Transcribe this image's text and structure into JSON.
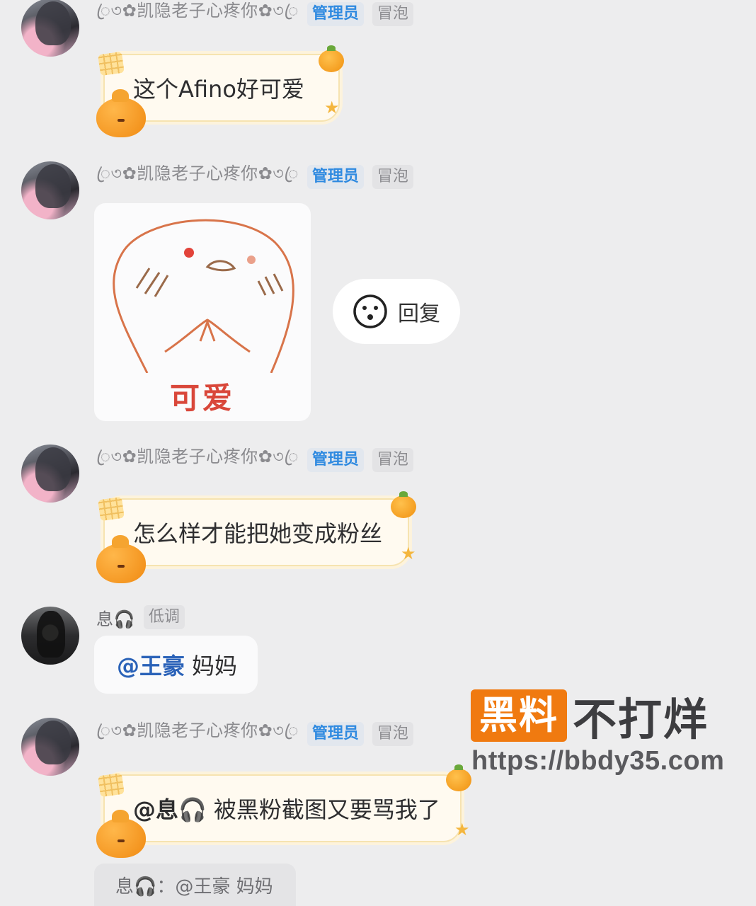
{
  "messages": [
    {
      "nickname": "ꦿ৩✿凯隐老子心疼你✿৩ꦿ",
      "badges": {
        "admin": "管理员",
        "bubble": "冒泡"
      },
      "text": "这个Afino好可爱"
    },
    {
      "nickname": "ꦿ৩✿凯隐老子心疼你✿৩ꦿ",
      "badges": {
        "admin": "管理员",
        "bubble": "冒泡"
      },
      "sticker_caption": "可爱"
    },
    {
      "nickname": "ꦿ৩✿凯隐老子心疼你✿৩ꦿ",
      "badges": {
        "admin": "管理员",
        "bubble": "冒泡"
      },
      "text": "怎么样才能把她变成粉丝"
    },
    {
      "nickname": "息🎧",
      "badges": {
        "level": "低调"
      },
      "mention": "@王豪",
      "text": "妈妈"
    },
    {
      "nickname": "ꦿ৩✿凯隐老子心疼你✿৩ꦿ",
      "badges": {
        "admin": "管理员",
        "bubble": "冒泡"
      },
      "mention": "@息🎧",
      "text": "被黑粉截图又要骂我了",
      "quote": "息🎧：@王豪 妈妈"
    }
  ],
  "reply_popup": {
    "label": "回复",
    "icon": "smiley-icon"
  },
  "watermark": {
    "box": "黑料",
    "text": "不打烊",
    "url": "https://bbdy35.com"
  },
  "colors": {
    "admin_badge": "#2f8ae0",
    "watermark_orange": "#f07a10",
    "background": "#ededee"
  }
}
